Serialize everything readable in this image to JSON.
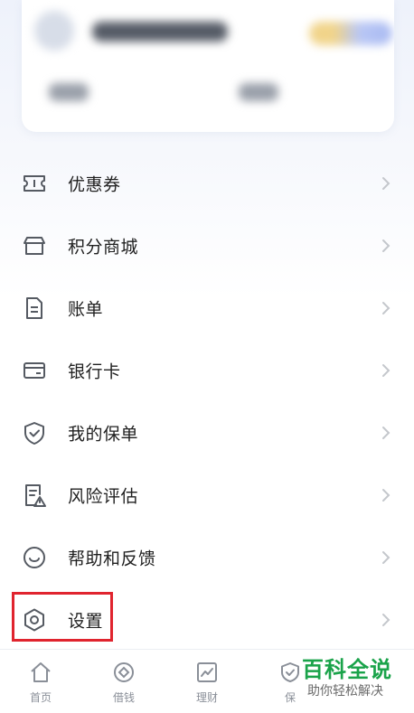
{
  "menu": {
    "items": [
      {
        "label": "优惠券",
        "icon": "ticket-icon"
      },
      {
        "label": "积分商城",
        "icon": "store-icon"
      },
      {
        "label": "账单",
        "icon": "bill-icon"
      },
      {
        "label": "银行卡",
        "icon": "bank-card-icon"
      },
      {
        "label": "我的保单",
        "icon": "shield-check-icon"
      },
      {
        "label": "风险评估",
        "icon": "risk-assessment-icon"
      },
      {
        "label": "帮助和反馈",
        "icon": "smile-icon"
      },
      {
        "label": "设置",
        "icon": "gear-icon"
      }
    ]
  },
  "tabbar": {
    "tabs": [
      {
        "label": "首页",
        "icon": "home-icon"
      },
      {
        "label": "借钱",
        "icon": "loan-icon"
      },
      {
        "label": "理财",
        "icon": "chart-icon"
      },
      {
        "label": "保",
        "icon": "shield-icon"
      }
    ]
  },
  "watermark": {
    "title": "百科全说",
    "subtitle": "助你轻松解决"
  },
  "colors": {
    "highlight": "#e0242e",
    "watermark": "#1aa34a",
    "icon": "#555a62",
    "chevron": "#c4c7cc"
  }
}
